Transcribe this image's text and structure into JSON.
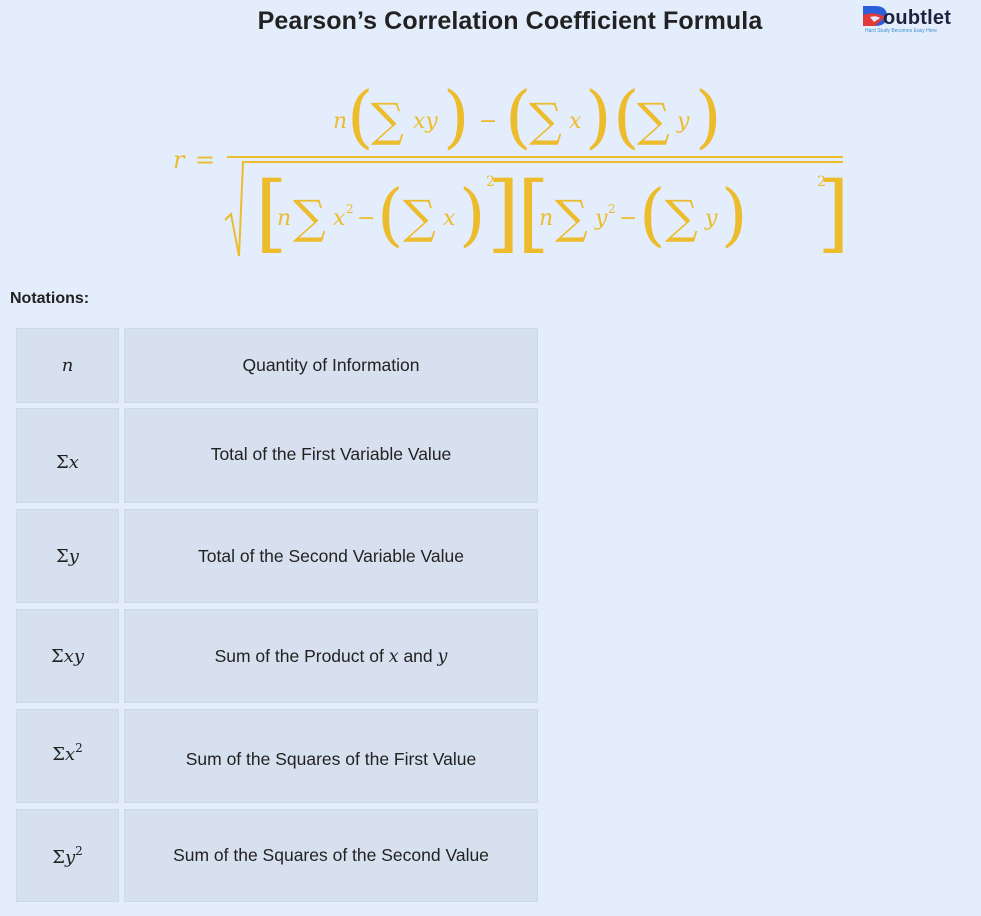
{
  "header": {
    "title": "Pearson’s Correlation Coefficient Formula",
    "logo": {
      "icon": "doubtlet-b-logo-icon",
      "wordmark": "oubtlet",
      "tagline": "Hard Study Becomes Easy Here",
      "colors": {
        "red": "#e23a3a",
        "blue": "#2b5fd9",
        "text": "#1e2340",
        "tagline": "#3e8fd0"
      }
    }
  },
  "formula": {
    "lhs": "r =",
    "numerator": "n(∑xy) − (∑x)(∑y)",
    "denominator": "√([n∑x² − (∑x)²][n∑y² − (∑y)²])",
    "color": "#ecbc2d",
    "parts": {
      "r": "r",
      "eq": "=",
      "n": "n",
      "sigma": "∑",
      "xy": "xy",
      "x": "x",
      "y": "y",
      "minus": "−",
      "two": "2",
      "lparen": "(",
      "rparen": ")",
      "lbrack": "[",
      "rbrack": "]"
    }
  },
  "notations": {
    "label": "Notations:",
    "rows": [
      {
        "symbol": "n",
        "description": "Quantity of Information"
      },
      {
        "symbol": "Σx",
        "description": "Total of the First Variable Value"
      },
      {
        "symbol": "Σy",
        "description": "Total of the Second Variable Value"
      },
      {
        "symbol": "Σxy",
        "description_parts": [
          "Sum of the Product of ",
          "x",
          " and ",
          "y"
        ]
      },
      {
        "symbol": "Σx²",
        "description": "Sum of the Squares of the First Value"
      },
      {
        "symbol": "Σy²",
        "description": "Sum of the Squares of the Second Value"
      }
    ],
    "symbol_parts": {
      "sigma": "Σ",
      "n": "n",
      "x": "x",
      "y": "y",
      "xy": "xy",
      "sq": "2"
    }
  }
}
